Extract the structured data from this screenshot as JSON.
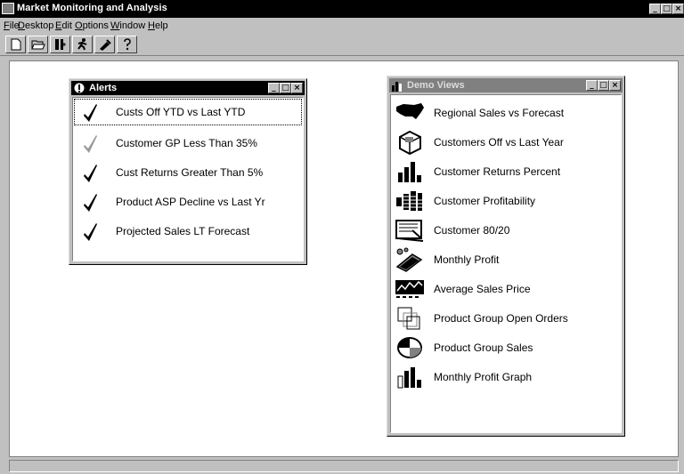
{
  "app": {
    "title": "Market Monitoring and Analysis"
  },
  "menu": [
    "File",
    "Desktop",
    "Edit",
    "Options",
    "Window",
    "Help"
  ],
  "toolbar": {
    "buttons": [
      {
        "name": "new-document-icon",
        "glyph": "🗋"
      },
      {
        "name": "open-folder-icon",
        "glyph": "🗁"
      },
      {
        "name": "insert-icon",
        "glyph": "⇥"
      },
      {
        "name": "run-icon",
        "glyph": "⚡"
      },
      {
        "name": "tools-icon",
        "glyph": "✎"
      },
      {
        "name": "help-icon",
        "glyph": "?"
      }
    ]
  },
  "alerts": {
    "title": "Alerts",
    "items": [
      {
        "label": "Custs Off YTD vs Last YTD",
        "color": "#000000"
      },
      {
        "label": "Customer GP Less Than 35%",
        "color": "#9a9a9a"
      },
      {
        "label": "Cust Returns Greater Than 5%",
        "color": "#000000"
      },
      {
        "label": "Product ASP Decline vs Last Yr",
        "color": "#000000"
      },
      {
        "label": "Projected Sales LT Forecast",
        "color": "#000000"
      }
    ]
  },
  "demo_views": {
    "title": "Demo Views",
    "items": [
      {
        "label": "Regional Sales vs Forecast",
        "icon": "map-icon"
      },
      {
        "label": "Customers Off vs Last Year",
        "icon": "cube-icon"
      },
      {
        "label": "Customer Returns Percent",
        "icon": "bar-chart-icon"
      },
      {
        "label": "Customer Profitability",
        "icon": "stack-icon"
      },
      {
        "label": "Customer 80/20",
        "icon": "document-chart-icon"
      },
      {
        "label": "Monthly Profit",
        "icon": "money-icon"
      },
      {
        "label": "Average Sales Price",
        "icon": "line-chart-icon"
      },
      {
        "label": "Product Group Open Orders",
        "icon": "overlap-squares-icon"
      },
      {
        "label": "Product Group Sales",
        "icon": "pie-chart-icon"
      },
      {
        "label": "Monthly Profit Graph",
        "icon": "bar-chart-icon"
      }
    ]
  }
}
